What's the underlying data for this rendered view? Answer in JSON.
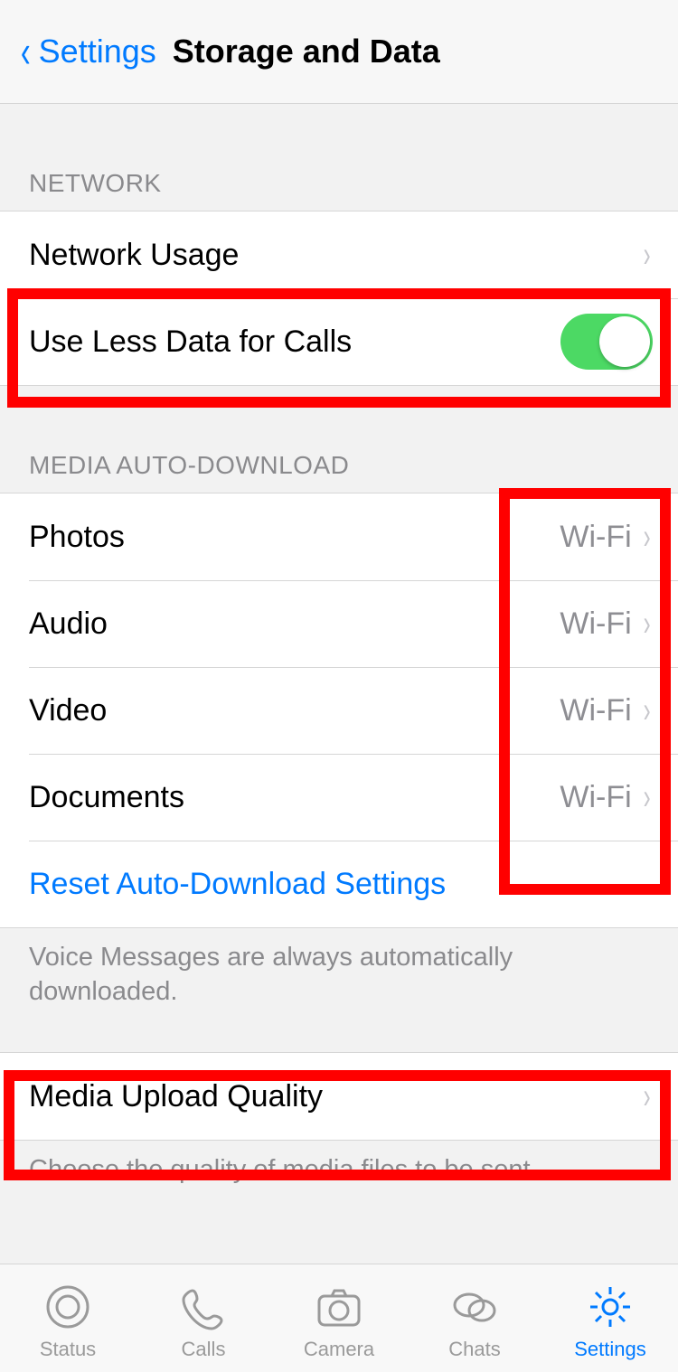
{
  "nav": {
    "back_label": "Settings",
    "title": "Storage and Data"
  },
  "sections": {
    "network": {
      "header": "NETWORK",
      "rows": {
        "usage_label": "Network Usage",
        "less_data_label": "Use Less Data for Calls",
        "less_data_on": true
      }
    },
    "media": {
      "header": "MEDIA AUTO-DOWNLOAD",
      "rows": [
        {
          "label": "Photos",
          "value": "Wi-Fi"
        },
        {
          "label": "Audio",
          "value": "Wi-Fi"
        },
        {
          "label": "Video",
          "value": "Wi-Fi"
        },
        {
          "label": "Documents",
          "value": "Wi-Fi"
        }
      ],
      "reset_label": "Reset Auto-Download Settings",
      "footer": "Voice Messages are always automatically downloaded."
    },
    "upload": {
      "row_label": "Media Upload Quality",
      "footer": "Choose the quality of media files to be sent."
    }
  },
  "tabs": [
    {
      "label": "Status"
    },
    {
      "label": "Calls"
    },
    {
      "label": "Camera"
    },
    {
      "label": "Chats"
    },
    {
      "label": "Settings"
    }
  ],
  "active_tab_index": 4,
  "annotations": [
    {
      "note": "use-less-data row highlight"
    },
    {
      "note": "wifi values column highlight"
    },
    {
      "note": "media upload quality row highlight"
    }
  ],
  "colors": {
    "accent": "#007aff",
    "switch_on": "#4cd964",
    "annotation": "#ff0000"
  }
}
